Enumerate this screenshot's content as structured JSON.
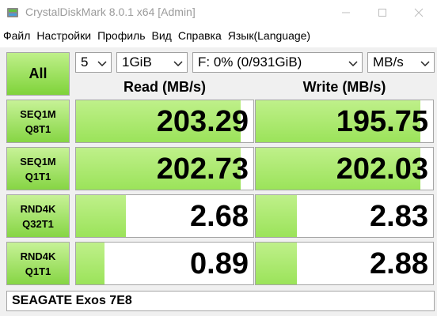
{
  "window": {
    "title": "CrystalDiskMark 8.0.1 x64 [Admin]"
  },
  "menu": [
    "Файл",
    "Настройки",
    "Профиль",
    "Вид",
    "Справка",
    "Язык(Language)"
  ],
  "toolbar": {
    "all_label": "All",
    "count": "5",
    "size": "1GiB",
    "drive": "F: 0% (0/931GiB)",
    "unit": "MB/s"
  },
  "headers": {
    "read": "Read (MB/s)",
    "write": "Write (MB/s)"
  },
  "tests": [
    {
      "line1": "SEQ1M",
      "line2": "Q8T1",
      "read": "203.29",
      "write": "195.75",
      "read_fill": 0.93,
      "write_fill": 0.93
    },
    {
      "line1": "SEQ1M",
      "line2": "Q1T1",
      "read": "202.73",
      "write": "202.03",
      "read_fill": 0.93,
      "write_fill": 0.93
    },
    {
      "line1": "RND4K",
      "line2": "Q32T1",
      "read": "2.68",
      "write": "2.83",
      "read_fill": 0.28,
      "write_fill": 0.23
    },
    {
      "line1": "RND4K",
      "line2": "Q1T1",
      "read": "0.89",
      "write": "2.88",
      "read_fill": 0.16,
      "write_fill": 0.23
    }
  ],
  "comment": "SEAGATE Exos 7E8",
  "colors": {
    "accent_green": "#86d544",
    "bar_green": "#bff08a"
  }
}
